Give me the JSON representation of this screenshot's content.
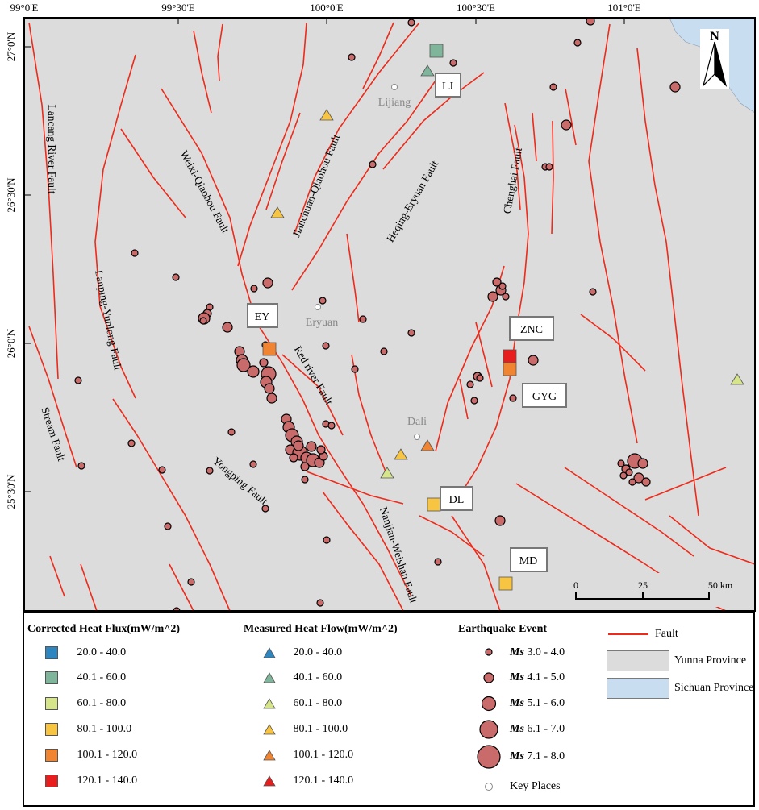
{
  "axes": {
    "lon_ticks": [
      "99°0'E",
      "99°30'E",
      "100°0'E",
      "100°30'E",
      "101°0'E"
    ],
    "lat_ticks": [
      "27°0'N",
      "26°30'N",
      "26°0'N",
      "25°30'N"
    ]
  },
  "colors": {
    "fault": "#ee2a1a",
    "yunnan": "#dcdcdc",
    "sichuan": "#c8ddf0",
    "quake": "#c96b6b",
    "heat": [
      "#2e86c1",
      "#7fb59a",
      "#d6e48a",
      "#f7c542",
      "#f08430",
      "#e81d1d"
    ]
  },
  "faults": [
    "Lancang River Fault",
    "Lanping-Yunlong Fault",
    "Stream Fault",
    "Weixi-Qiaohou Fault",
    "Jianchuan-Qiaohou Fault",
    "Heqing-Eryuan Fault",
    "Chenghai Fault",
    "Red river Fault",
    "Yongping Fault",
    "Nanjian-Weishan Fault"
  ],
  "places": [
    {
      "name": "Lijiang",
      "label": "LJ"
    },
    {
      "name": "Eryuan",
      "label": "EY"
    },
    {
      "name": "Dali",
      "label": "DL"
    },
    {
      "name": "",
      "label": "ZNC"
    },
    {
      "name": "",
      "label": "GYG"
    },
    {
      "name": "",
      "label": "MD"
    }
  ],
  "scale_bar": {
    "ticks": [
      "0",
      "25",
      "50 km"
    ]
  },
  "north": "N",
  "legend": {
    "corrected_title": "Corrected Heat Flux(mW/m^2)",
    "measured_title": "Measured Heat Flow(mW/m^2)",
    "eq_title": "Earthquake Event",
    "classes": [
      "20.0 - 40.0",
      "40.1 - 60.0",
      "60.1 - 80.0",
      "80.1 - 100.0",
      "100.1 - 120.0",
      "120.1 - 140.0"
    ],
    "eq_prefix": "Ms",
    "eq_classes": [
      "3.0 - 4.0",
      "4.1 - 5.0",
      "5.1 - 6.0",
      "6.1 - 7.0",
      "7.1 - 8.0"
    ],
    "key_places": "Key Places",
    "fault": "Fault",
    "yunnan": "Yunna Province",
    "sichuan": "Sichuan Province"
  }
}
